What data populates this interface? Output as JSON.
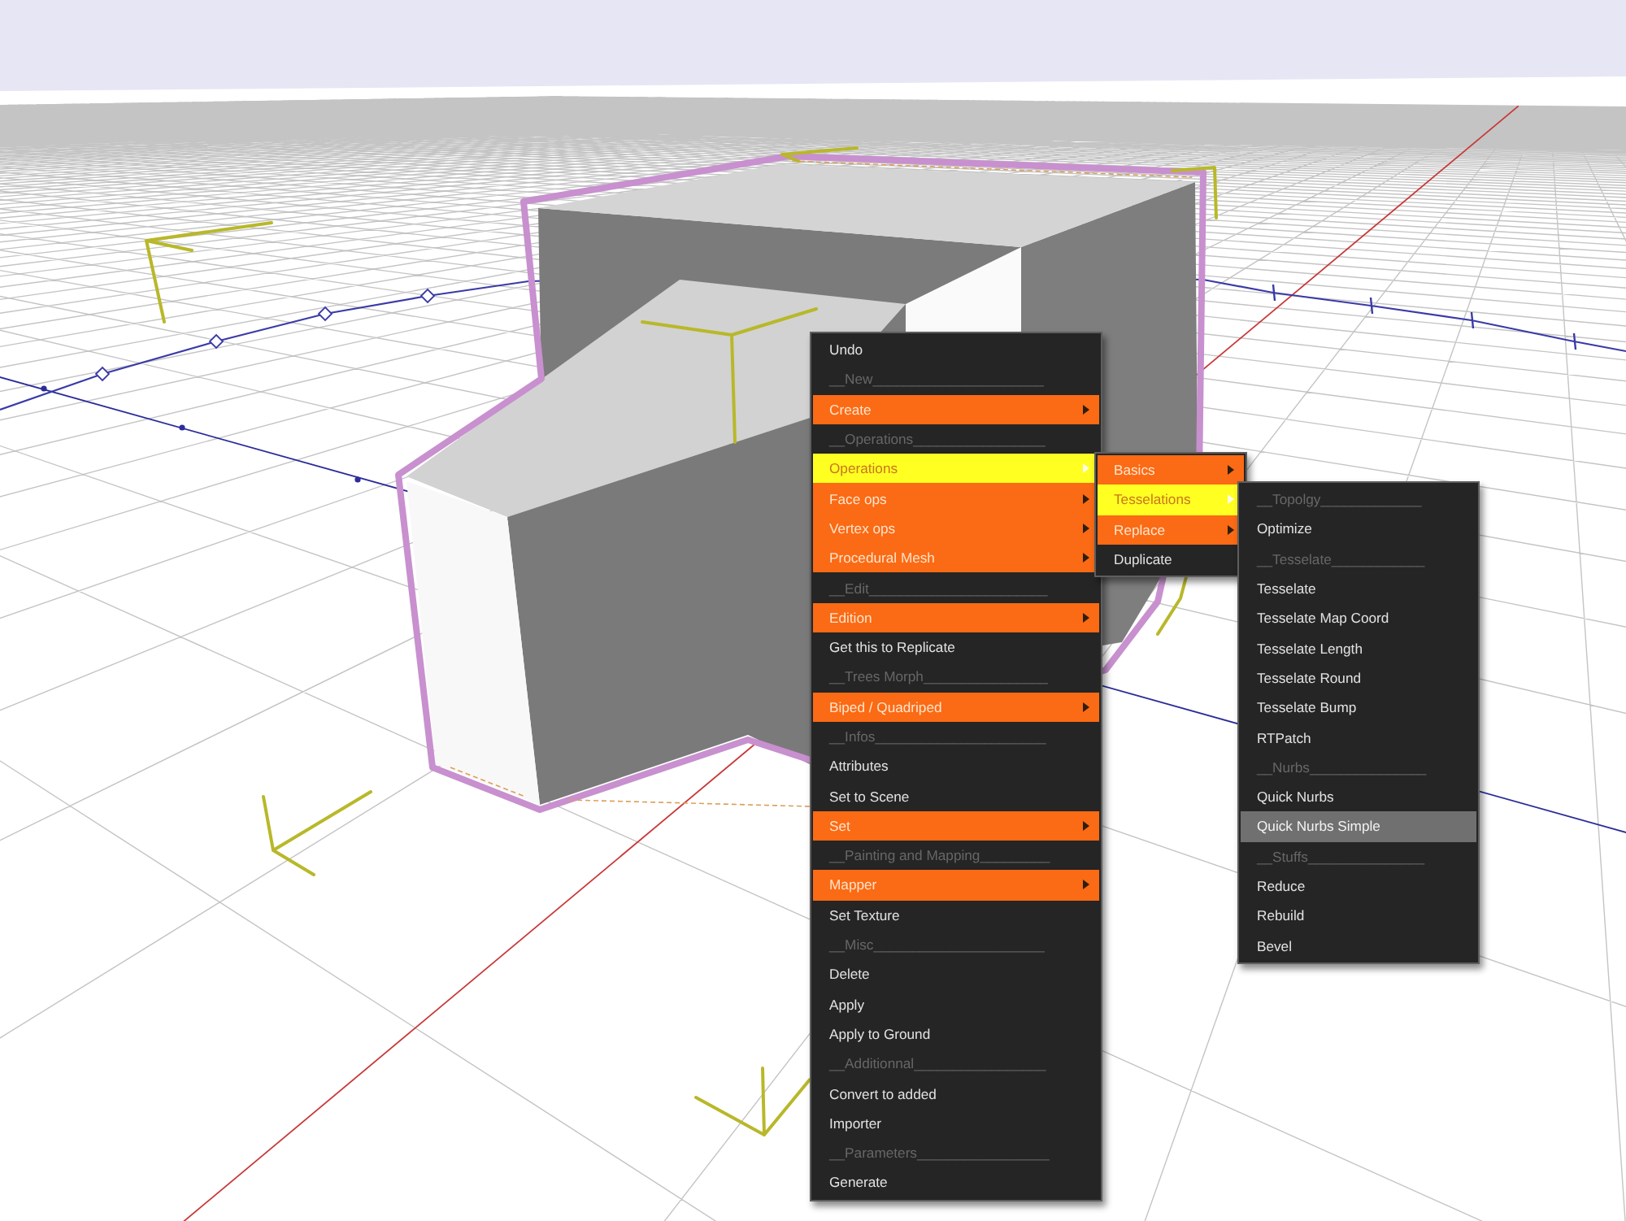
{
  "context_menu": {
    "items": [
      {
        "kind": "action",
        "label": "Undo",
        "selected": false
      },
      {
        "kind": "header",
        "label": "__New______________________",
        "selected": false
      },
      {
        "kind": "submenu",
        "label": "Create",
        "selected": false
      },
      {
        "kind": "header",
        "label": "__Operations_________________",
        "selected": false
      },
      {
        "kind": "submenu",
        "label": "Operations",
        "selected": true
      },
      {
        "kind": "submenu",
        "label": "Face ops",
        "selected": false
      },
      {
        "kind": "submenu",
        "label": "Vertex ops",
        "selected": false
      },
      {
        "kind": "submenu",
        "label": "Procedural Mesh",
        "selected": false
      },
      {
        "kind": "header",
        "label": "__Edit_______________________",
        "selected": false
      },
      {
        "kind": "submenu",
        "label": "Edition",
        "selected": false
      },
      {
        "kind": "action",
        "label": "Get this to Replicate",
        "selected": false
      },
      {
        "kind": "header",
        "label": "__Trees Morph________________",
        "selected": false
      },
      {
        "kind": "submenu",
        "label": "Biped / Quadriped",
        "selected": false
      },
      {
        "kind": "header",
        "label": "__Infos______________________",
        "selected": false
      },
      {
        "kind": "action",
        "label": "Attributes",
        "selected": false
      },
      {
        "kind": "action",
        "label": "Set to Scene",
        "selected": false
      },
      {
        "kind": "submenu",
        "label": "Set",
        "selected": false
      },
      {
        "kind": "header",
        "label": "__Painting and Mapping_________",
        "selected": false
      },
      {
        "kind": "submenu",
        "label": "Mapper",
        "selected": false
      },
      {
        "kind": "action",
        "label": "Set Texture",
        "selected": false
      },
      {
        "kind": "header",
        "label": "__Misc______________________",
        "selected": false
      },
      {
        "kind": "action",
        "label": "Delete",
        "selected": false
      },
      {
        "kind": "action",
        "label": "Apply",
        "selected": false
      },
      {
        "kind": "action",
        "label": "Apply to Ground",
        "selected": false
      },
      {
        "kind": "header",
        "label": "__Additionnal_________________",
        "selected": false
      },
      {
        "kind": "action",
        "label": "Convert to added",
        "selected": false
      },
      {
        "kind": "action",
        "label": "Importer",
        "selected": false
      },
      {
        "kind": "header",
        "label": "__Parameters_________________",
        "selected": false
      },
      {
        "kind": "action",
        "label": "Generate",
        "selected": false
      }
    ]
  },
  "operations_submenu": {
    "items": [
      {
        "kind": "submenu",
        "label": "Basics",
        "selected": false
      },
      {
        "kind": "submenu",
        "label": "Tesselations",
        "selected": true
      },
      {
        "kind": "submenu",
        "label": "Replace",
        "selected": false
      },
      {
        "kind": "action",
        "label": "Duplicate",
        "selected": false
      }
    ]
  },
  "tesselations_submenu": {
    "items": [
      {
        "kind": "header",
        "label": "__Topolgy_____________",
        "selected": false
      },
      {
        "kind": "action",
        "label": "Optimize",
        "selected": false
      },
      {
        "kind": "header",
        "label": "__Tesselate____________",
        "selected": false
      },
      {
        "kind": "action",
        "label": "Tesselate",
        "selected": false
      },
      {
        "kind": "action",
        "label": "Tesselate Map Coord",
        "selected": false
      },
      {
        "kind": "action",
        "label": "Tesselate Length",
        "selected": false
      },
      {
        "kind": "action",
        "label": "Tesselate Round",
        "selected": false
      },
      {
        "kind": "action",
        "label": "Tesselate Bump",
        "selected": false
      },
      {
        "kind": "action",
        "label": "RTPatch",
        "selected": false
      },
      {
        "kind": "header",
        "label": "__Nurbs_______________",
        "selected": false
      },
      {
        "kind": "action",
        "label": "Quick Nurbs",
        "selected": false
      },
      {
        "kind": "action",
        "label": "Quick Nurbs Simple",
        "selected": true
      },
      {
        "kind": "header",
        "label": "__Stuffs_______________",
        "selected": false
      },
      {
        "kind": "action",
        "label": "Reduce",
        "selected": false
      },
      {
        "kind": "action",
        "label": "Rebuild",
        "selected": false
      },
      {
        "kind": "action",
        "label": "Bevel",
        "selected": false
      }
    ]
  }
}
